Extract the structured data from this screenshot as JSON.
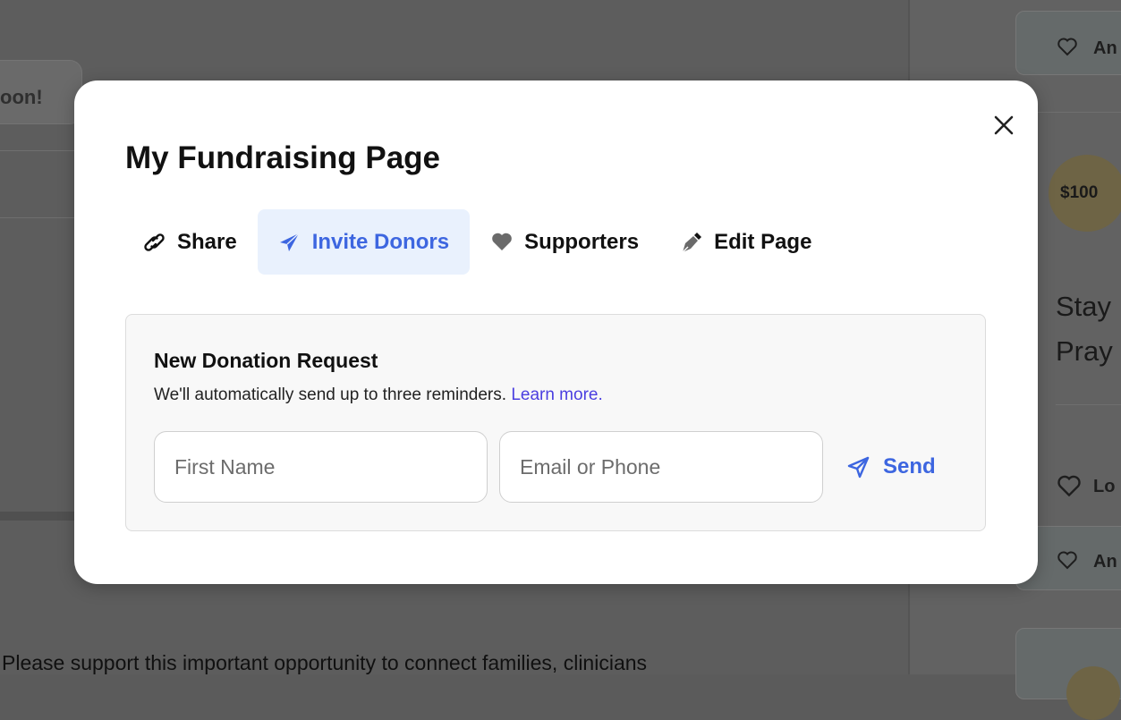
{
  "background": {
    "button_text": "oon!",
    "footer_text": "Please support this important opportunity to connect families, clinicians",
    "right_cards": [
      {
        "label": "An"
      },
      {
        "label": "Lo"
      },
      {
        "label": "An"
      }
    ],
    "amount_badge": "$100",
    "heading_line1": "Stay",
    "heading_line2": "Pray"
  },
  "modal": {
    "title": "My Fundraising Page",
    "tabs": [
      {
        "label": "Share",
        "icon": "link-icon"
      },
      {
        "label": "Invite Donors",
        "icon": "paper-plane-icon"
      },
      {
        "label": "Supporters",
        "icon": "heart-icon"
      },
      {
        "label": "Edit Page",
        "icon": "pen-icon"
      }
    ],
    "active_tab": "Invite Donors",
    "request": {
      "title": "New Donation Request",
      "description": "We'll automatically send up to three reminders.",
      "learn_more": "Learn more.",
      "first_name_placeholder": "First Name",
      "contact_placeholder": "Email or Phone",
      "send_label": "Send"
    }
  },
  "colors": {
    "accent": "#3d66e0",
    "active_tab_bg": "#e9f1fd",
    "link": "#4b3fe0",
    "overlay": "#5b5b5b"
  }
}
